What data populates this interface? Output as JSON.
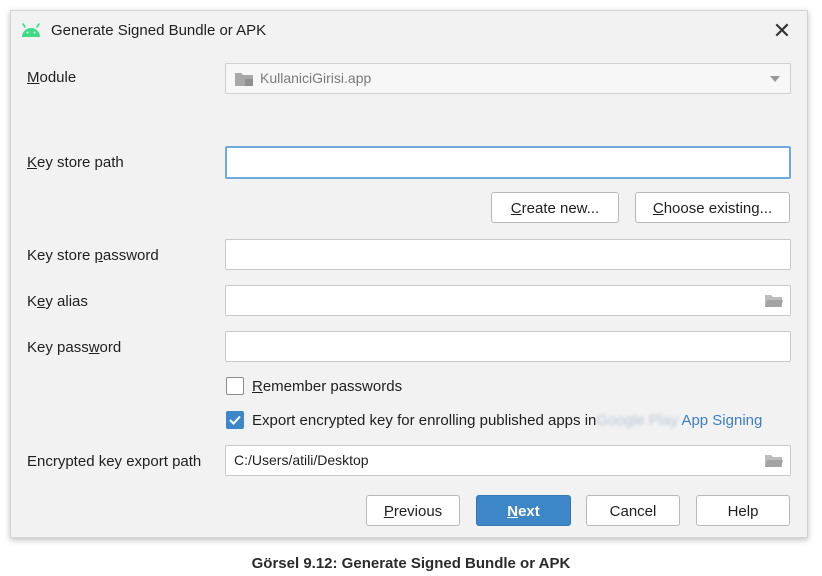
{
  "dialog": {
    "title": "Generate Signed Bundle or APK",
    "close_symbol": "✕"
  },
  "module": {
    "label_mnemonic": "M",
    "label_rest": "odule",
    "value": "KullaniciGirisi.app"
  },
  "key_store_path": {
    "label_mnemonic": "K",
    "label_rest": "ey store path",
    "value": ""
  },
  "buttons": {
    "create_new_mnemonic": "C",
    "create_new_rest": "reate new...",
    "choose_existing_mnemonic": "C",
    "choose_existing_rest": "hoose existing...",
    "previous_mnemonic": "P",
    "previous_rest": "revious",
    "next_mnemonic": "N",
    "next_rest": "ext",
    "cancel": "Cancel",
    "help": "Help"
  },
  "key_store_password": {
    "label_pre": "Key store ",
    "label_mnemonic": "p",
    "label_rest": "assword",
    "value": ""
  },
  "key_alias": {
    "label_pre": "K",
    "label_mnemonic": "e",
    "label_rest": "y alias",
    "value": ""
  },
  "key_password": {
    "label_pre": "Key pass",
    "label_mnemonic": "w",
    "label_rest": "ord",
    "value": ""
  },
  "remember_passwords": {
    "checked": false,
    "label_mnemonic": "R",
    "label_rest": "emember passwords"
  },
  "export_encrypted": {
    "checked": true,
    "label_text": "Export encrypted key for enrolling published apps in",
    "label_blurred": "Google Play",
    "label_link": "App Signing"
  },
  "encrypted_key_export_path": {
    "label": "Encrypted key export path",
    "value": "C:/Users/atili/Desktop"
  },
  "caption": "Görsel 9.12: Generate Signed Bundle or APK",
  "icons": {
    "app": "android-icon",
    "module": "module-folder-icon",
    "folder": "folder-icon",
    "dropdown": "chevron-down-icon",
    "check": "checkmark-icon"
  },
  "colors": {
    "accent": "#3d86c8",
    "focus_border": "#6fa8dc",
    "link": "#3d7fc4",
    "android_green": "#3ddc84"
  }
}
